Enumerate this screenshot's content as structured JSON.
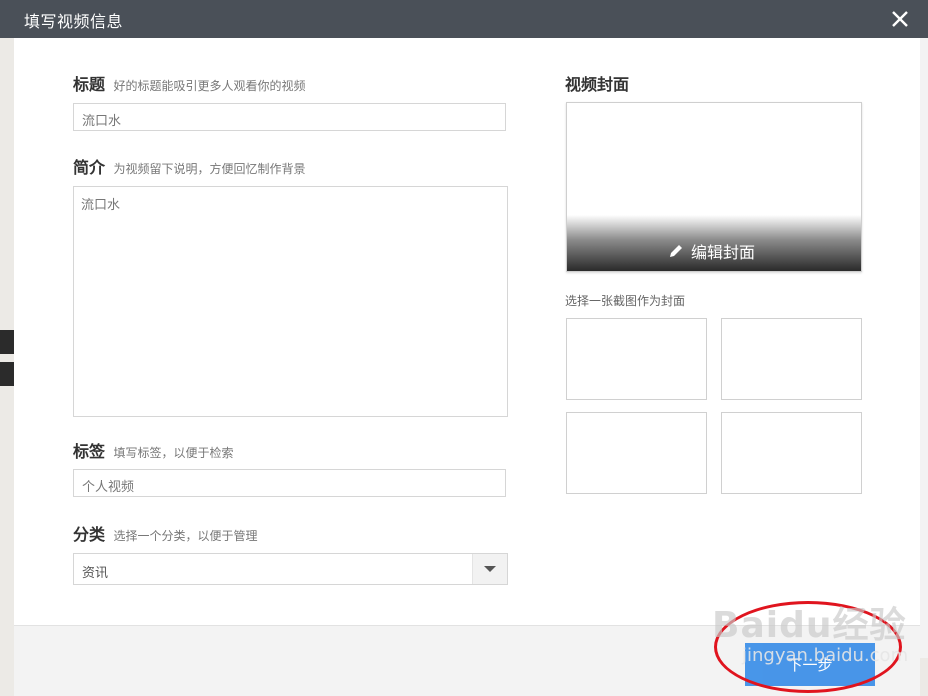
{
  "dialog": {
    "title": "填写视频信息"
  },
  "form": {
    "title_label": "标题",
    "title_hint": "好的标题能吸引更多人观看你的视频",
    "title_value": "流口水",
    "intro_label": "简介",
    "intro_hint": "为视频留下说明，方便回忆制作背景",
    "intro_value": "流口水",
    "tags_label": "标签",
    "tags_hint": "填写标签，以便于检索",
    "tags_value": "个人视频",
    "category_label": "分类",
    "category_hint": "选择一个分类，以便于管理",
    "category_value": "资讯"
  },
  "cover": {
    "title": "视频封面",
    "edit_label": "编辑封面",
    "screenshot_hint": "选择一张截图作为封面"
  },
  "footer": {
    "next_label": "下一步"
  },
  "watermark": {
    "main": "Baidu经验",
    "sub": "jingyan.baidu.com"
  },
  "colors": {
    "titlebar": "#4a5058",
    "primary_button": "#3a8ee8",
    "highlight": "#e0141e"
  }
}
